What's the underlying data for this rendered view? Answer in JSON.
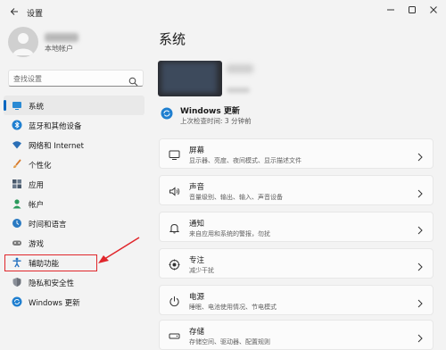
{
  "window": {
    "title": "设置"
  },
  "account": {
    "type": "本地帐户"
  },
  "search": {
    "placeholder": "查找设置"
  },
  "sidebar": {
    "items": [
      {
        "label": "系统",
        "icon": "monitor-icon",
        "active": true
      },
      {
        "label": "蓝牙和其他设备",
        "icon": "bluetooth-icon"
      },
      {
        "label": "网络和 Internet",
        "icon": "wifi-icon"
      },
      {
        "label": "个性化",
        "icon": "brush-icon"
      },
      {
        "label": "应用",
        "icon": "apps-icon"
      },
      {
        "label": "帐户",
        "icon": "person-icon"
      },
      {
        "label": "时间和语言",
        "icon": "globe-clock-icon"
      },
      {
        "label": "游戏",
        "icon": "gamepad-icon"
      },
      {
        "label": "辅助功能",
        "icon": "accessibility-icon"
      },
      {
        "label": "隐私和安全性",
        "icon": "shield-icon"
      },
      {
        "label": "Windows 更新",
        "icon": "update-icon"
      }
    ]
  },
  "main": {
    "title": "系统",
    "windows_update": {
      "title": "Windows 更新",
      "subtitle": "上次检查时间: 3 分钟前"
    },
    "cards": [
      {
        "title": "屏幕",
        "subtitle": "显示器、亮度、夜间模式、显示描述文件",
        "icon": "display-icon"
      },
      {
        "title": "声音",
        "subtitle": "音量级别、输出、输入、声音设备",
        "icon": "speaker-icon"
      },
      {
        "title": "通知",
        "subtitle": "来自应用和系统的警报，勿扰",
        "icon": "bell-icon"
      },
      {
        "title": "专注",
        "subtitle": "减少干扰",
        "icon": "focus-icon"
      },
      {
        "title": "电源",
        "subtitle": "睡眠、电池使用情况、节电模式",
        "icon": "power-icon"
      },
      {
        "title": "存储",
        "subtitle": "存储空间、驱动器、配置规则",
        "icon": "storage-icon"
      }
    ]
  },
  "colors": {
    "accent": "#0067c0",
    "highlight": "#e0262b"
  }
}
